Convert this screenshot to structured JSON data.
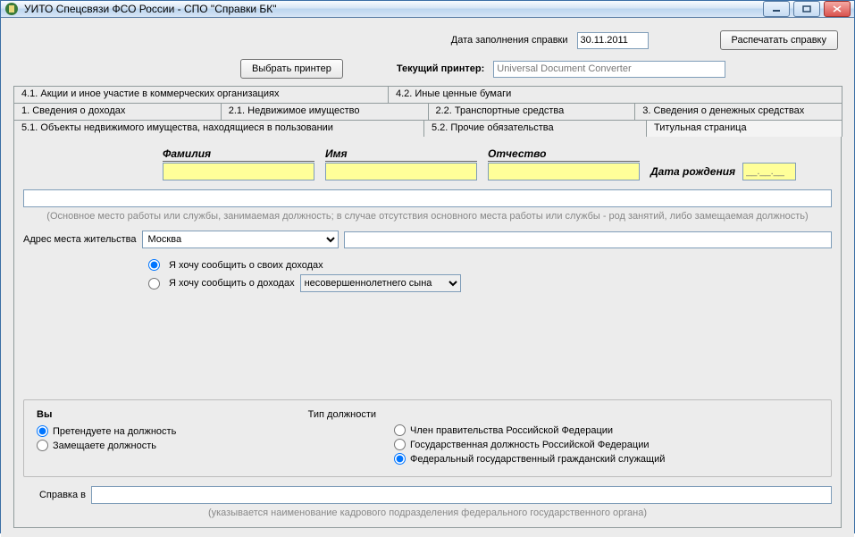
{
  "window_title": "УИТО Спецсвязи ФСО России - СПО \"Справки БК\"",
  "toolbar": {
    "date_label": "Дата заполнения справки",
    "date_value": "30.11.2011",
    "print_button": "Распечатать справку",
    "choose_printer": "Выбрать принтер",
    "current_printer_label": "Текущий принтер:",
    "current_printer_value": "Universal Document Converter"
  },
  "tabs": {
    "row1": [
      "4.1. Акции и иное участие в коммерческих организациях",
      "4.2. Иные ценные бумаги"
    ],
    "row2": [
      "1. Сведения о доходах",
      "2.1. Недвижимое имущество",
      "2.2. Транспортные средства",
      "3. Сведения о денежных средствах"
    ],
    "row3": [
      "5.1. Объекты недвижимого имущества, находящиеся в пользовании",
      "5.2. Прочие обязательства",
      "Титульная страница"
    ]
  },
  "form": {
    "lastname_label": "Фамилия",
    "firstname_label": "Имя",
    "patronymic_label": "Отчество",
    "dob_label": "Дата рождения",
    "dob_placeholder": "__.__.__",
    "position_hint": "(Основное место работы или службы, занимаемая должность; в случае отсутствия основного места работы или службы - род занятий, либо замещаемая должность)",
    "address_label": "Адрес места жительства",
    "address_value": "Москва",
    "radio_self": "Я хочу сообщить о своих доходах",
    "radio_other": "Я хочу сообщить о доходах",
    "other_subject": "несовершеннолетнего сына"
  },
  "bottom": {
    "vy_label": "Вы",
    "pos_type_label": "Тип должности",
    "left": [
      "Претендуете на должность",
      "Замещаете должность"
    ],
    "right": [
      "Член правительства Российской Федерации",
      "Государственная должность Российской Федерации",
      "Федеральный государственный гражданский служащий"
    ],
    "spravka_label": "Справка в",
    "footer_hint": "(указывается наименование кадрового подразделения федерального государственного органа)"
  }
}
